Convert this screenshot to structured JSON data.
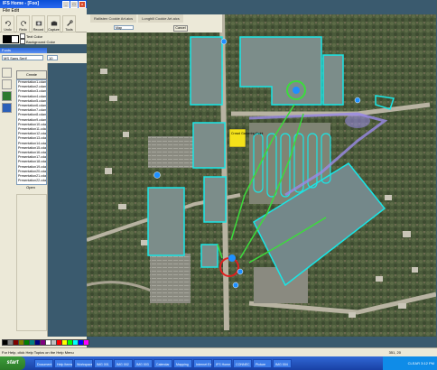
{
  "app": {
    "title": "IFS Home - [Foo]",
    "menu": "File  Edit"
  },
  "toolbar": {
    "buttons": [
      {
        "label": "Undo"
      },
      {
        "label": "Redo"
      },
      {
        "label": "Record"
      },
      {
        "label": "Capture"
      },
      {
        "label": "Tools"
      }
    ]
  },
  "options": {
    "text_color_label": "Text Color",
    "background_color_label": "Background Color"
  },
  "font": {
    "section_title": "Fonts",
    "name": "MS Sans Serif",
    "size": "10"
  },
  "panel": {
    "create_label": "Create",
    "open_label": "Open",
    "files": [
      "Presentation1.cdaml.xml",
      "Presentation2.cdaml.xml",
      "Presentation3.cdaml.xml",
      "Presentation4.cdaml.xml",
      "Presentation5.cdaml.xml",
      "Presentation6.cdaml.xml",
      "Presentation7.cdaml.xml",
      "Presentation8.cdaml.xml",
      "Presentation9.cdaml.xml",
      "Presentation10.cdaml.xml",
      "Presentation11.cdaml.xml",
      "Presentation12.cdaml.xml",
      "Presentation13.cdaml.xml",
      "Presentation14.cdaml.xml",
      "Presentation15.cdaml.xml",
      "Presentation16.cdaml.xml",
      "Presentation17.cdaml.xml",
      "Presentation18.cdaml.xml",
      "Presentation19.cdaml.xml",
      "Presentation20.cdaml.xml",
      "Presentation21.cdaml.xml",
      "Presentation22.cdaml.xml"
    ]
  },
  "map": {
    "tabs": [
      "Rallisten Cookie Art.aics",
      "Longhill Cookie Art.aics"
    ],
    "view_select": "Map",
    "cancel_label": "Cancel",
    "note_label": "Crowd Gathering Point"
  },
  "status": {
    "help_text": "For Help, click Help Topics on the Help Menu",
    "coords": "351, 20"
  },
  "taskbar": {
    "start_label": "start",
    "items": [
      "Document",
      "Help Items",
      "Workspace",
      "IMG 001",
      "IMG 002",
      "IMG 003",
      "Calendar",
      "Mapping",
      "Internet Ex",
      "IFS Home",
      "CONNEC",
      "Picture",
      "IMG 004"
    ],
    "clock": "CLEAR 3:12 PM"
  },
  "colors": {
    "accent": "#0a4fd6",
    "overlay_cyan": "#19e6e6",
    "overlay_green": "#3cdc3c",
    "marker_red": "#e02020",
    "note_yellow": "#f4e21a"
  }
}
